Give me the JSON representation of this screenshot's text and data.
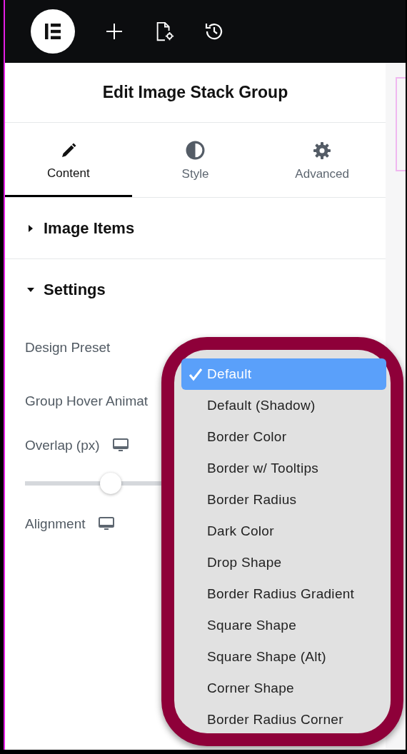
{
  "panel": {
    "title": "Edit Image Stack Group"
  },
  "tabs": [
    {
      "label": "Content",
      "selected": true
    },
    {
      "label": "Style",
      "selected": false
    },
    {
      "label": "Advanced",
      "selected": false
    }
  ],
  "sections": [
    {
      "title": "Image Items",
      "expanded": false
    },
    {
      "title": "Settings",
      "expanded": true
    }
  ],
  "controls": [
    {
      "kind": "select",
      "label": "Design Preset"
    },
    {
      "kind": "select",
      "label": "Group Hover Animat"
    },
    {
      "kind": "slider",
      "label": "Overlap (px)",
      "level": 0.4
    },
    {
      "kind": "choice",
      "label": "Alignment"
    }
  ],
  "dropdown": {
    "options": [
      {
        "label": "Default",
        "selected": true
      },
      {
        "label": "Default (Shadow)",
        "selected": false
      },
      {
        "label": "Border Color",
        "selected": false
      },
      {
        "label": "Border w/ Tooltips",
        "selected": false
      },
      {
        "label": "Border Radius",
        "selected": false
      },
      {
        "label": "Dark Color",
        "selected": false
      },
      {
        "label": "Drop Shape",
        "selected": false
      },
      {
        "label": "Border Radius Gradient",
        "selected": false
      },
      {
        "label": "Square Shape",
        "selected": false
      },
      {
        "label": "Square Shape (Alt)",
        "selected": false
      },
      {
        "label": "Corner Shape",
        "selected": false
      },
      {
        "label": "Border Radius Corner",
        "selected": false
      }
    ]
  }
}
